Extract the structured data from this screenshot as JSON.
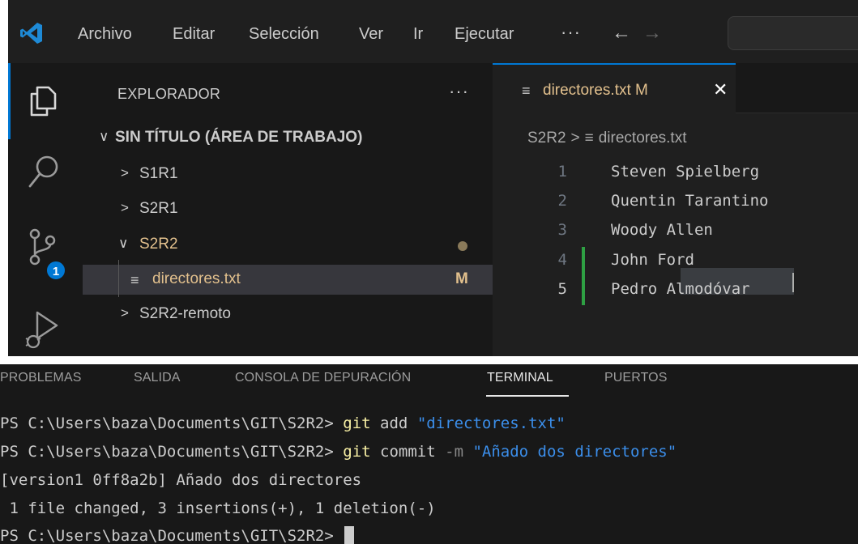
{
  "menu": {
    "items": [
      "Archivo",
      "Editar",
      "Selección",
      "Ver",
      "Ir",
      "Ejecutar"
    ],
    "more": "···",
    "back": "←",
    "forward": "→"
  },
  "activity_bar": {
    "source_control_badge": "1"
  },
  "explorer": {
    "title": "EXPLORADOR",
    "more": "···",
    "workspace": "SIN TÍTULO (ÁREA DE TRABAJO)",
    "folders": [
      "S1R1",
      "S2R1",
      "S2R2",
      "S2R2-remoto"
    ],
    "open_file": "directores.txt",
    "open_file_status": "M"
  },
  "editor": {
    "tab_name": "directores.txt",
    "tab_status": "M",
    "tab_close": "✕",
    "breadcrumb": [
      "S2R2",
      ">",
      "directores.txt"
    ],
    "lines": [
      {
        "num": "1",
        "text": "Steven Spielberg"
      },
      {
        "num": "2",
        "text": "Quentin Tarantino"
      },
      {
        "num": "3",
        "text": "Woody Allen"
      },
      {
        "num": "4",
        "text": "John Ford"
      },
      {
        "num": "5",
        "text": "Pedro Almodóvar"
      }
    ]
  },
  "panel": {
    "tabs": [
      "PROBLEMAS",
      "SALIDA",
      "CONSOLA DE DEPURACIÓN",
      "TERMINAL",
      "PUERTOS"
    ],
    "active_tab": "TERMINAL"
  },
  "terminal": {
    "prompt": "PS C:\\Users\\baza\\Documents\\GIT\\S2R2>",
    "cmd1": {
      "git": "git",
      "sub": "add",
      "arg": "\"directores.txt\""
    },
    "cmd2": {
      "git": "git",
      "sub": "commit",
      "flag": "-m",
      "arg": "\"Añado dos directores\""
    },
    "out1": "[version1 0ff8a2b] Añado dos directores",
    "out2": " 1 file changed, 3 insertions(+), 1 deletion(-)"
  },
  "colors": {
    "accent": "#0078d4",
    "modified": "#e2c08d",
    "added_gutter": "#2ea043",
    "git_yellow": "#f9f1a5",
    "string_blue": "#3b8eea"
  }
}
